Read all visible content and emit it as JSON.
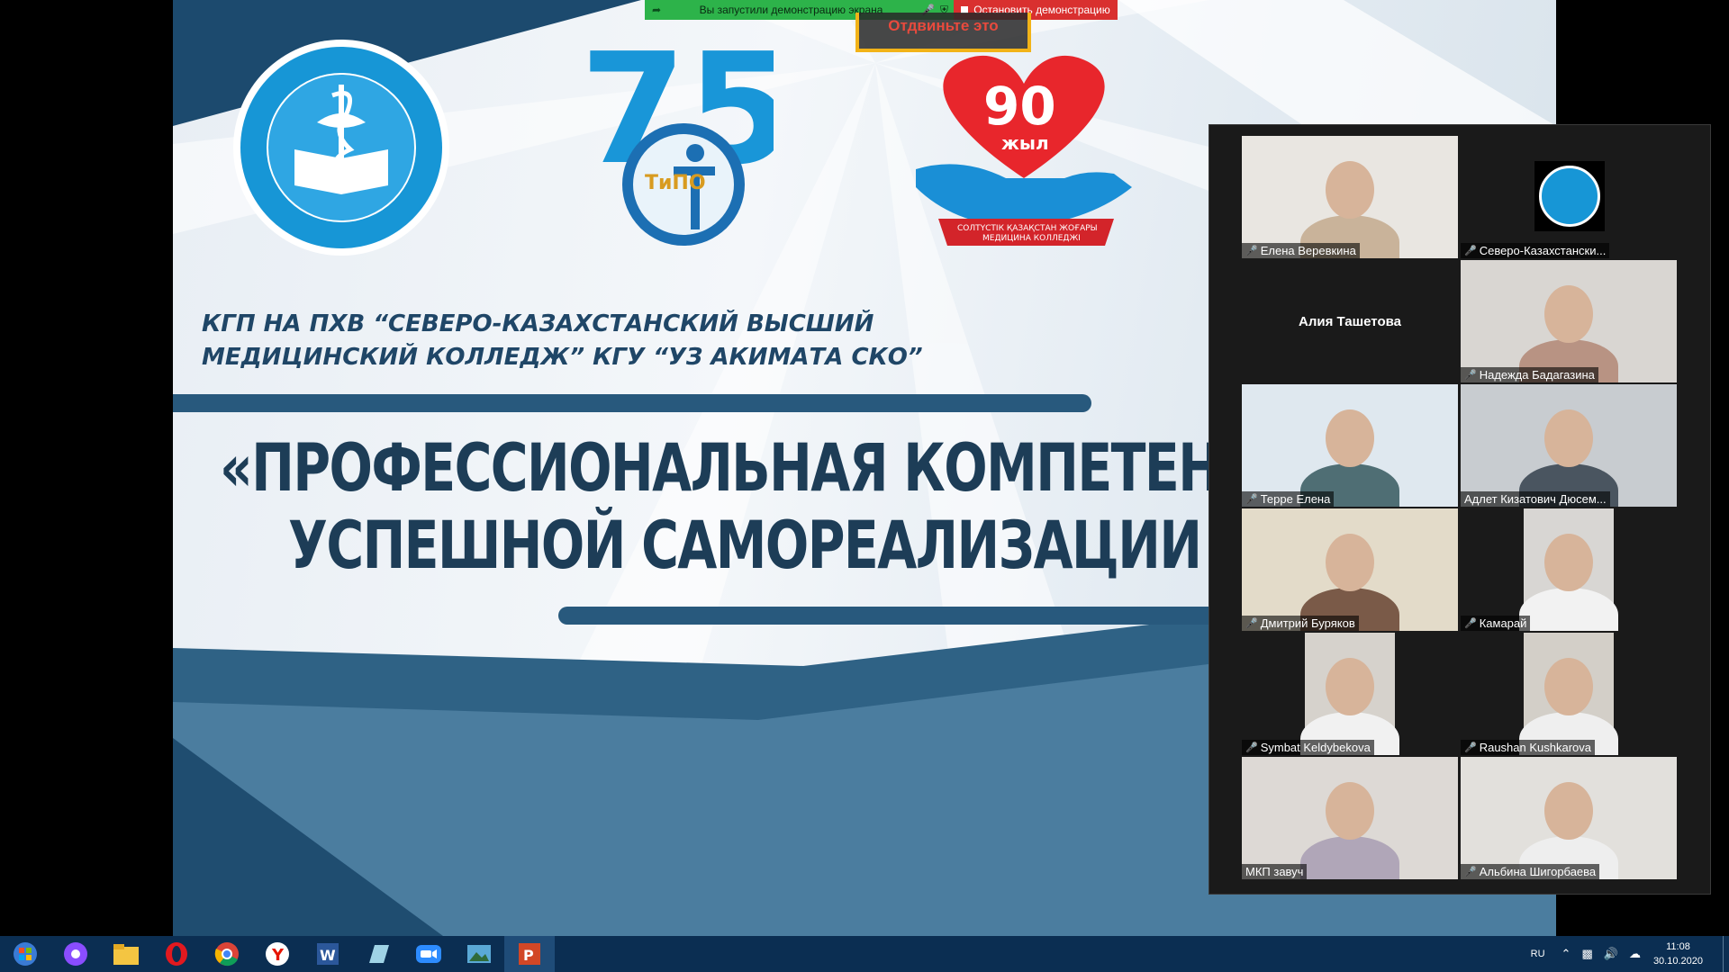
{
  "slide": {
    "org_line1": "КГП НА ПХВ “СЕВЕРО-КАЗАХСТАНСКИЙ ВЫСШИЙ",
    "org_line2": "МЕДИЦИНСКИЙ КОЛЛЕДЖ” КГУ “УЗ АКИМАТА СКО”",
    "title_line1": "«ПРОФЕССИОНАЛЬНАЯ КОМПЕТЕНТНОСТЬ",
    "title_line2": "УСПЕШНОЙ САМОРЕАЛИЗАЦИИ ВЫПУС",
    "logo_left_text": "СОЛТҮСТІК ҚАЗАҚСТАН ЖОҒАРЫ МЕДИЦИНА КОЛЛЕДЖІ",
    "logo_mid_number": "75",
    "logo_mid_text": "ТиПО",
    "logo_right_number": "90",
    "logo_right_word": "жыл",
    "logo_right_ribbon": "СОЛТҮСТІК ҚАЗАҚСТАН ЖОҒАРЫ МЕДИЦИНА КОЛЛЕДЖІ"
  },
  "share": {
    "status_text": "Вы запустили демонстрацию экрана",
    "stop_label": "Остановить демонстрацию",
    "unmute_hint": "Отдвиньте это"
  },
  "gallery": {
    "participants": [
      {
        "name": "Елена Веревкина",
        "muted": true
      },
      {
        "name": "Северо-Казахстански...",
        "muted": true
      },
      {
        "name": "Алия Ташетова",
        "muted": false,
        "name_only": true
      },
      {
        "name": "Надежда Бадагазина",
        "muted": true
      },
      {
        "name": "Терре Елена",
        "muted": true
      },
      {
        "name": "Адлет Кизатович Дюсем...",
        "muted": false
      },
      {
        "name": "Дмитрий Буряков",
        "muted": true
      },
      {
        "name": "Камарай",
        "muted": true
      },
      {
        "name": "Symbat Keldybekova",
        "muted": true
      },
      {
        "name": "Raushan Kushkarova",
        "muted": true
      },
      {
        "name": "МКП завуч",
        "muted": false
      },
      {
        "name": "Альбина Шигорбаева",
        "muted": true
      }
    ]
  },
  "taskbar": {
    "apps": [
      "start",
      "alice",
      "file-explorer",
      "opera",
      "chrome",
      "yandex-browser",
      "word",
      "notes",
      "zoom",
      "photos",
      "powerpoint"
    ],
    "lang": "RU",
    "time": "11:08",
    "date": "30.10.2020"
  },
  "colors": {
    "slide_navy": "#1d3d57",
    "bar_blue": "#28597d",
    "share_green": "#2db34a",
    "stop_red": "#d9302f",
    "active_speaker": "#d5ec4a",
    "taskbar": "#0b2e52"
  }
}
